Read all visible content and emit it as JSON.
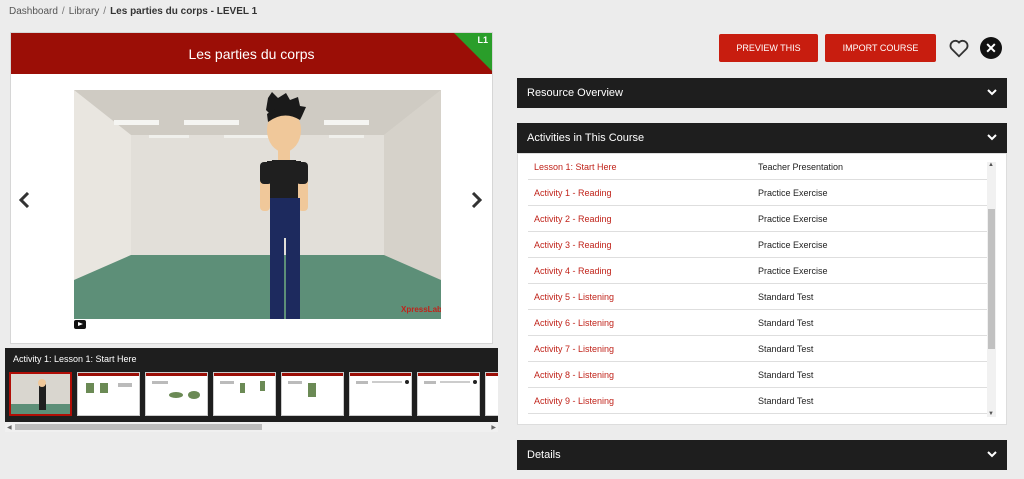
{
  "breadcrumb": {
    "items": [
      "Dashboard",
      "Library"
    ],
    "current": "Les parties du corps - LEVEL 1"
  },
  "slide": {
    "title": "Les parties du corps",
    "level_badge": "L1",
    "watermark": "XpressLab"
  },
  "strip": {
    "title": "Activity 1: Lesson 1: Start Here",
    "thumb_count": 8
  },
  "actions": {
    "preview": "PREVIEW THIS",
    "import": "IMPORT COURSE"
  },
  "panels": {
    "overview": "Resource Overview",
    "activities": "Activities in This Course",
    "details": "Details"
  },
  "activities": [
    {
      "name": "Lesson 1: Start Here",
      "type": "Teacher Presentation"
    },
    {
      "name": "Activity 1 - Reading",
      "type": "Practice Exercise"
    },
    {
      "name": "Activity 2 - Reading",
      "type": "Practice Exercise"
    },
    {
      "name": "Activity 3 - Reading",
      "type": "Practice Exercise"
    },
    {
      "name": "Activity 4 - Reading",
      "type": "Practice Exercise"
    },
    {
      "name": "Activity 5 - Listening",
      "type": "Standard Test"
    },
    {
      "name": "Activity 6 - Listening",
      "type": "Standard Test"
    },
    {
      "name": "Activity 7 - Listening",
      "type": "Standard Test"
    },
    {
      "name": "Activity 8 - Listening",
      "type": "Standard Test"
    },
    {
      "name": "Activity 9 - Listening",
      "type": "Standard Test"
    }
  ],
  "colors": {
    "brand_red": "#c81d0f",
    "header_red": "#9b0e06",
    "level_green": "#2a9e2a",
    "dark": "#1e1e1e"
  }
}
